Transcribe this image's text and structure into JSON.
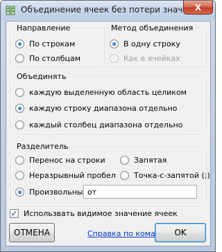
{
  "window": {
    "title": "Объединение ячеек без потери значен...",
    "close_glyph": "X"
  },
  "direction": {
    "legend": "Направление",
    "options": [
      {
        "label": "По строкам",
        "checked": true
      },
      {
        "label": "По столбцам",
        "checked": false
      }
    ]
  },
  "method": {
    "legend": "Метод объединения",
    "options": [
      {
        "label": "В одну строку",
        "checked": true,
        "disabled": false
      },
      {
        "label": "Как в ячейках",
        "checked": false,
        "disabled": true
      }
    ]
  },
  "merge": {
    "legend": "Объединять",
    "options": [
      {
        "label": "каждую выделенную область целиком",
        "checked": false
      },
      {
        "label": "каждую строку диапазона отдельно",
        "checked": true
      },
      {
        "label": "каждый столбец диапазона отдельно",
        "checked": false
      }
    ]
  },
  "separator": {
    "legend": "Разделитель",
    "options": {
      "newline": {
        "label": "Перенос на строки",
        "checked": false
      },
      "comma": {
        "label": "Запятая",
        "checked": false
      },
      "nbsp": {
        "label": "Неразрывный пробел",
        "checked": false
      },
      "semicolon": {
        "label": "Точка-с-запятой (;)",
        "checked": false
      },
      "custom": {
        "label": "Произвольный",
        "checked": true
      }
    },
    "custom_value": "от"
  },
  "use_visible": {
    "label": "Использвать видимое значение ячеек",
    "checked": true,
    "check_glyph": "✓"
  },
  "buttons": {
    "cancel": "ОТМЕНА",
    "help": "Справка по команде",
    "ok": "OK"
  },
  "colors": {
    "link": "#0033cc",
    "radio_selected": "#1e5fb4",
    "close_button": "#c0412b"
  }
}
